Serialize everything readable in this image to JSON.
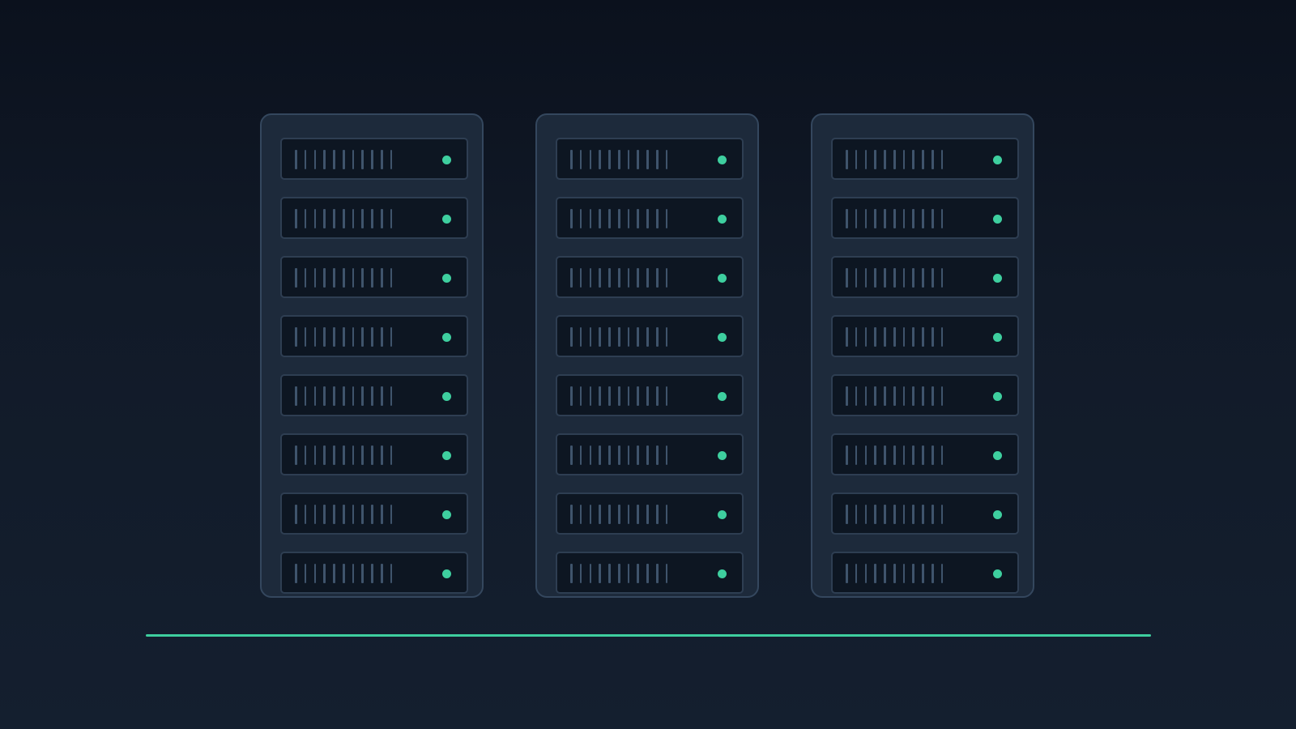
{
  "scene": {
    "racks": [
      {
        "units": 8,
        "leds": [
          "on",
          "on",
          "on",
          "on",
          "on",
          "on",
          "on",
          "on"
        ]
      },
      {
        "units": 8,
        "leds": [
          "on",
          "on",
          "on",
          "on",
          "on",
          "on",
          "on",
          "on"
        ]
      },
      {
        "units": 8,
        "leds": [
          "on",
          "on",
          "on",
          "on",
          "on",
          "on",
          "on",
          "on"
        ]
      }
    ],
    "vents_per_unit": 11
  },
  "colors": {
    "accent": "#3ecf9f",
    "rack_body": "#1d2a3b",
    "rack_border": "#34475e",
    "unit_body": "#0d1622",
    "vent": "#3f546c"
  },
  "icons": {
    "rack": "server-rack-icon",
    "led": "status-led-icon"
  }
}
